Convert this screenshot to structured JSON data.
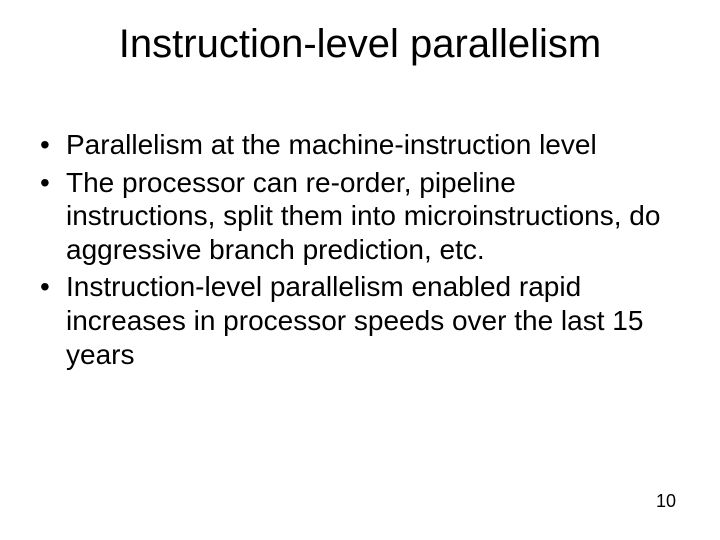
{
  "slide": {
    "title": "Instruction-level parallelism",
    "bullets": [
      "Parallelism at the machine-instruction level",
      "The processor can re-order, pipeline instructions, split them into microinstructions, do aggressive branch prediction, etc.",
      "Instruction-level parallelism enabled rapid increases in processor speeds over the last 15 years"
    ],
    "page_number": "10"
  }
}
